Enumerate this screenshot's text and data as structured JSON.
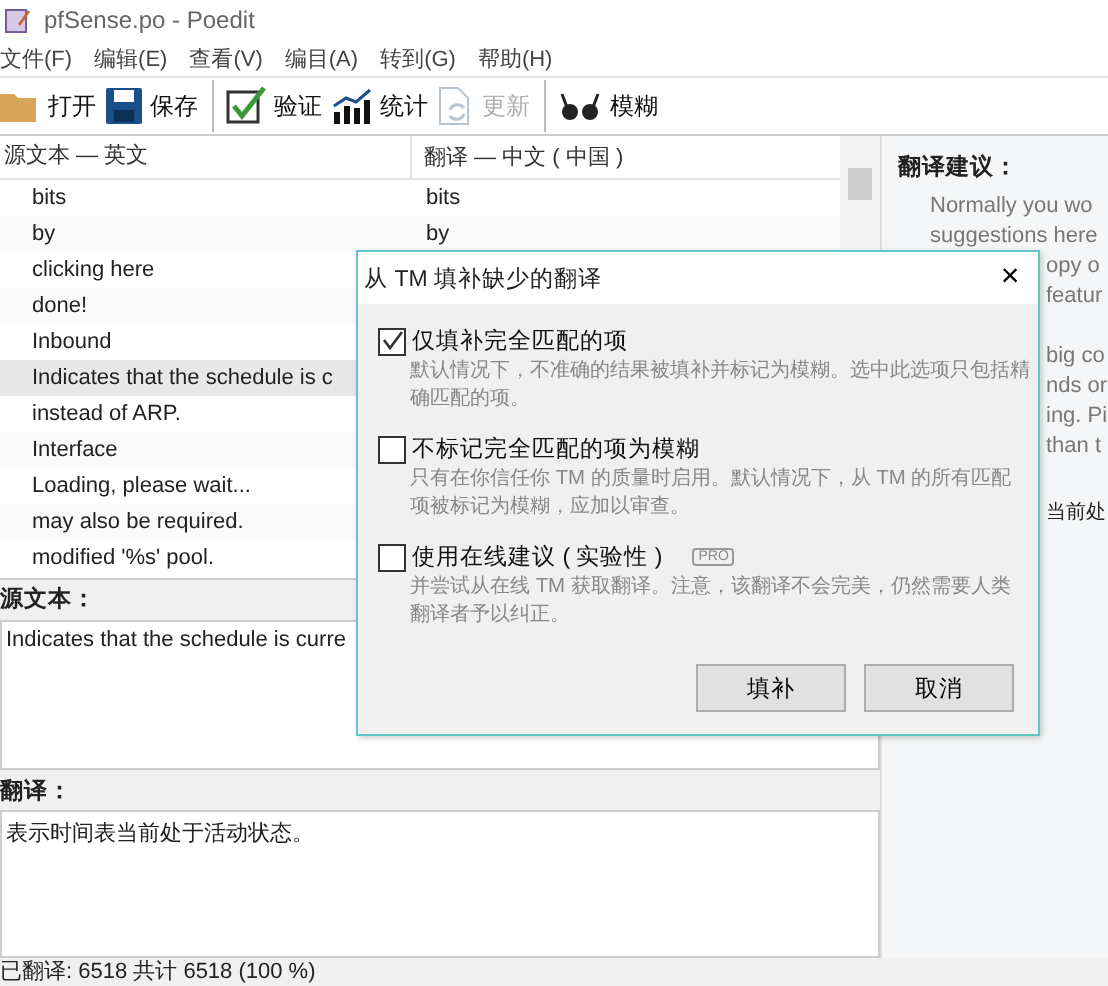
{
  "window": {
    "title": "pfSense.po - Poedit"
  },
  "menu": [
    "文件(F)",
    "编辑(E)",
    "查看(V)",
    "编目(A)",
    "转到(G)",
    "帮助(H)"
  ],
  "toolbar": [
    {
      "kind": "open",
      "label": "打开",
      "disabled": false
    },
    {
      "kind": "save",
      "label": "保存",
      "disabled": false
    },
    {
      "kind": "validate",
      "label": "验证",
      "disabled": false
    },
    {
      "kind": "stats",
      "label": "统计",
      "disabled": false
    },
    {
      "kind": "update",
      "label": "更新",
      "disabled": true
    },
    {
      "kind": "fuzzy",
      "label": "模糊",
      "disabled": false
    }
  ],
  "list": {
    "columns": [
      "源文本 — 英文",
      "翻译 — 中文 ( 中国 )"
    ],
    "rows": [
      {
        "source": "bits",
        "translation": "bits",
        "selected": false
      },
      {
        "source": "by",
        "translation": "by",
        "selected": false
      },
      {
        "source": "clicking here",
        "selected": false
      },
      {
        "source": "done!",
        "selected": false
      },
      {
        "source": "Inbound",
        "selected": false
      },
      {
        "source": "Indicates that the schedule is c",
        "selected": true
      },
      {
        "source": "instead of ARP.",
        "selected": false
      },
      {
        "source": "Interface",
        "selected": false
      },
      {
        "source": "Loading, please wait...",
        "selected": false
      },
      {
        "source": "may also be required.",
        "selected": false
      },
      {
        "source": "modified '%s' pool.",
        "selected": false
      }
    ]
  },
  "source_label": "源文本：",
  "source_text": "Indicates that the schedule is curre",
  "translation_label": "翻译：",
  "translation_text": "表示时间表当前处于活动状态。",
  "suggestions": {
    "title": "翻译建议：",
    "lines": [
      {
        "text": "Normally you wo",
        "covered": false
      },
      {
        "text": "suggestions here",
        "covered": false
      },
      {
        "text": "opy o",
        "covered": true
      },
      {
        "text": "featur",
        "covered": true
      },
      {
        "text": "big co",
        "covered": true
      },
      {
        "text": "nds or",
        "covered": true
      },
      {
        "text": "ing. Pi",
        "covered": true
      },
      {
        "text": "than t",
        "covered": true
      },
      {
        "text": "当前处",
        "covered": true
      }
    ]
  },
  "status_bar": "已翻译: 6518 共计 6518 (100 %)",
  "dialog": {
    "title": "从 TM 填补缺少的翻译",
    "close": "×",
    "options": [
      {
        "label": "仅填补完全匹配的项",
        "checked": true,
        "description": "默认情况下，不准确的结果被填补并标记为模糊。选中此选项只包括精确匹配的项。"
      },
      {
        "label": "不标记完全匹配的项为模糊",
        "checked": false,
        "description": "只有在你信任你 TM 的质量时启用。默认情况下，从 TM 的所有匹配项被标记为模糊，应加以审查。"
      },
      {
        "label": "使用在线建议 ( 实验性 )",
        "checked": false,
        "badge": "PRO",
        "description": "并尝试从在线 TM 获取翻译。注意，该翻译不会完美，仍然需要人类翻译者予以纠正。"
      }
    ],
    "buttons": [
      "填补",
      "取消"
    ]
  }
}
